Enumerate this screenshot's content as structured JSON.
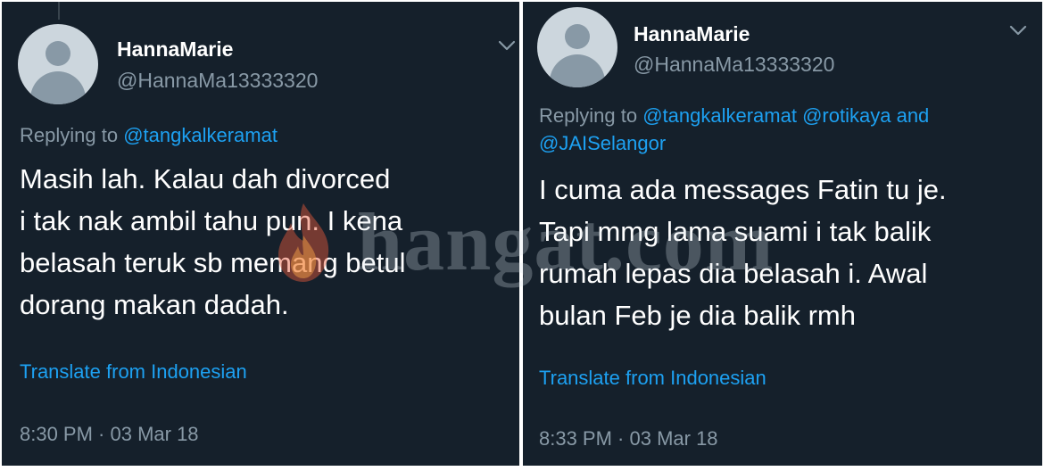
{
  "tweets": [
    {
      "display_name": "HannaMarie",
      "handle": "@HannaMa13333320",
      "reply_prefix": "Replying to",
      "reply_mentions": [
        "@tangkalkeramat"
      ],
      "reply_and": "",
      "text": "Masih lah. Kalau dah divorced\ni tak nak ambil tahu pun. I kena\nbelasah teruk sb memang betul\ndorang makan dadah.",
      "translate_label": "Translate from Indonesian",
      "timestamp": "8:30 PM · 03 Mar 18"
    },
    {
      "display_name": "HannaMarie",
      "handle": "@HannaMa13333320",
      "reply_prefix": "Replying to",
      "reply_mentions": [
        "@tangkalkeramat",
        "@rotikaya",
        "@JAISelangor"
      ],
      "reply_and": "and",
      "text": "I cuma ada messages Fatin tu je.\nTapi mmg lama suami i tak balik\nrumah lepas dia belasah i. Awal\nbulan Feb je dia balik rmh",
      "translate_label": "Translate from Indonesian",
      "timestamp": "8:33 PM · 03 Mar 18"
    }
  ],
  "watermark": {
    "text": "hangat.com"
  },
  "icons": {
    "menu": "chevron-down-icon",
    "avatar": "default-avatar-icon",
    "watermark_logo": "flame-icon"
  },
  "colors": {
    "background": "#15202b",
    "primary_text": "#ffffff",
    "secondary_text": "#8899a6",
    "accent": "#1da1f2"
  }
}
